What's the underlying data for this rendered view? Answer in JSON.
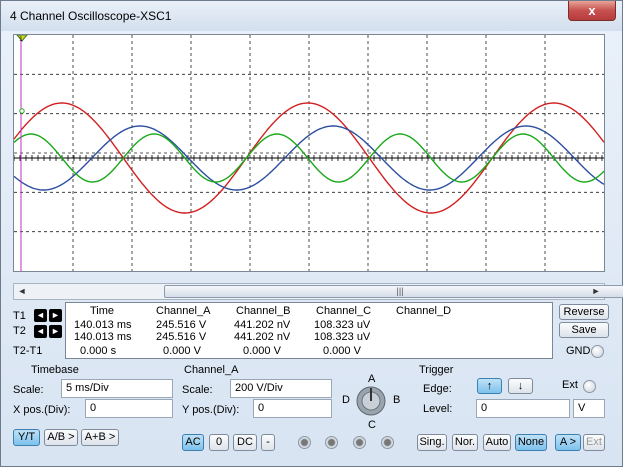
{
  "window": {
    "title": "4 Channel Oscilloscope-XSC1",
    "close_label": "x"
  },
  "scope": {
    "channel_colors": {
      "A": "#2c4fa0",
      "B": "#d21f1f",
      "C": "#1aa81a",
      "D": "#000000"
    },
    "cursor1_marker": "1"
  },
  "scrollbar": {
    "left_arrow": "◄",
    "right_arrow": "►",
    "thumb_grip": "|||"
  },
  "cursors": {
    "t1_label": "T1",
    "t2_label": "T2",
    "diff_label": "T2-T1",
    "left_arrow": "◄",
    "right_arrow": "►"
  },
  "readout": {
    "headers": [
      "Time",
      "Channel_A",
      "Channel_B",
      "Channel_C",
      "Channel_D"
    ],
    "rows": [
      [
        "140.013 ms",
        "245.516 V",
        "441.202 nV",
        "108.323 uV",
        ""
      ],
      [
        "140.013 ms",
        "245.516 V",
        "441.202 nV",
        "108.323 uV",
        ""
      ],
      [
        "0.000 s",
        "0.000 V",
        "0.000 V",
        "0.000 V",
        ""
      ]
    ]
  },
  "side_buttons": {
    "reverse": "Reverse",
    "save": "Save",
    "gnd": "GND"
  },
  "timebase": {
    "title": "Timebase",
    "scale_label": "Scale:",
    "scale_value": "5 ms/Div",
    "xpos_label": "X pos.(Div):",
    "xpos_value": "0",
    "yt": "Y/T",
    "ab": "A/B >",
    "aplusb": "A+B >"
  },
  "channel": {
    "title": "Channel_A",
    "scale_label": "Scale:",
    "scale_value": "200  V/Div",
    "ypos_label": "Y pos.(Div):",
    "ypos_value": "0",
    "ac": "AC",
    "zero": "0",
    "dc": "DC",
    "minus": "-",
    "knob_labels": {
      "a": "A",
      "b": "B",
      "c": "C",
      "d": "D"
    }
  },
  "trigger": {
    "title": "Trigger",
    "edge_label": "Edge:",
    "rising_icon": "↑",
    "falling_icon": "↓",
    "ext_label": "Ext",
    "level_label": "Level:",
    "level_value": "0",
    "level_unit": "V",
    "sing": "Sing.",
    "nor": "Nor.",
    "auto": "Auto",
    "none": "None",
    "a_src": "A >",
    "ext_src": "Ext"
  }
}
